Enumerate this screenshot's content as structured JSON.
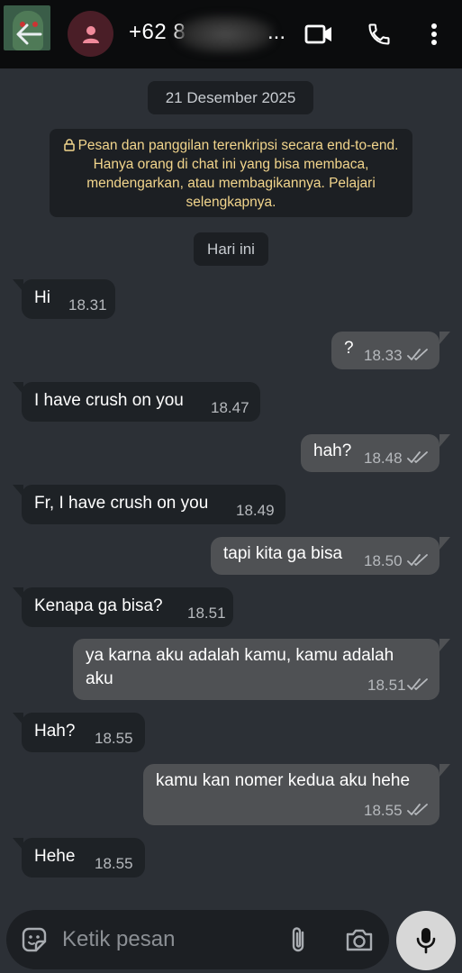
{
  "header": {
    "contact_name": "+62 8",
    "contact_ellipsis": "..."
  },
  "chat": {
    "date_chip": "21 Desember 2025",
    "encryption_notice": "Pesan dan panggilan terenkripsi secara end-to-end. Hanya orang di chat ini yang bisa membaca, mendengarkan, atau membagikannya. Pelajari selengkapnya.",
    "today_chip": "Hari ini",
    "messages": [
      {
        "dir": "in",
        "text": "Hi",
        "time": "18.31"
      },
      {
        "dir": "out",
        "text": "?",
        "time": "18.33"
      },
      {
        "dir": "in",
        "text": "I have crush on you",
        "time": "18.47"
      },
      {
        "dir": "out",
        "text": "hah?",
        "time": "18.48"
      },
      {
        "dir": "in",
        "text": "Fr, I have crush on you",
        "time": "18.49"
      },
      {
        "dir": "out",
        "text": "tapi kita ga bisa",
        "time": "18.50"
      },
      {
        "dir": "in",
        "text": "Kenapa ga bisa?",
        "time": "18.51"
      },
      {
        "dir": "out",
        "text_line1": "ya karna aku adalah kamu, kamu adalah",
        "text_line2": "aku",
        "time": "18.51"
      },
      {
        "dir": "in",
        "text": "Hah?",
        "time": "18.55"
      },
      {
        "dir": "out",
        "text": "kamu kan nomer kedua aku hehe",
        "time": "18.55"
      },
      {
        "dir": "in",
        "text": "Hehe",
        "time": "18.55"
      }
    ]
  },
  "input": {
    "placeholder": "Ketik pesan"
  },
  "colors": {
    "header_bg": "#0b0c0d",
    "chat_bg": "#2c3036",
    "incoming_bubble": "#1e2226",
    "outgoing_bubble": "#4f5154",
    "notice_text": "#f2d58c",
    "avatar_bg": "#4a1e27",
    "avatar_icon": "#f08a9b"
  },
  "icons": {
    "back": "arrow-left-icon",
    "avatar": "person-icon",
    "video_call": "video-camera-icon",
    "voice_call": "phone-icon",
    "menu": "more-vertical-icon",
    "lock": "lock-icon",
    "read_receipt": "double-check-icon",
    "emoji": "sticker-smile-icon",
    "attach": "paperclip-icon",
    "camera": "camera-icon",
    "mic": "microphone-icon"
  }
}
